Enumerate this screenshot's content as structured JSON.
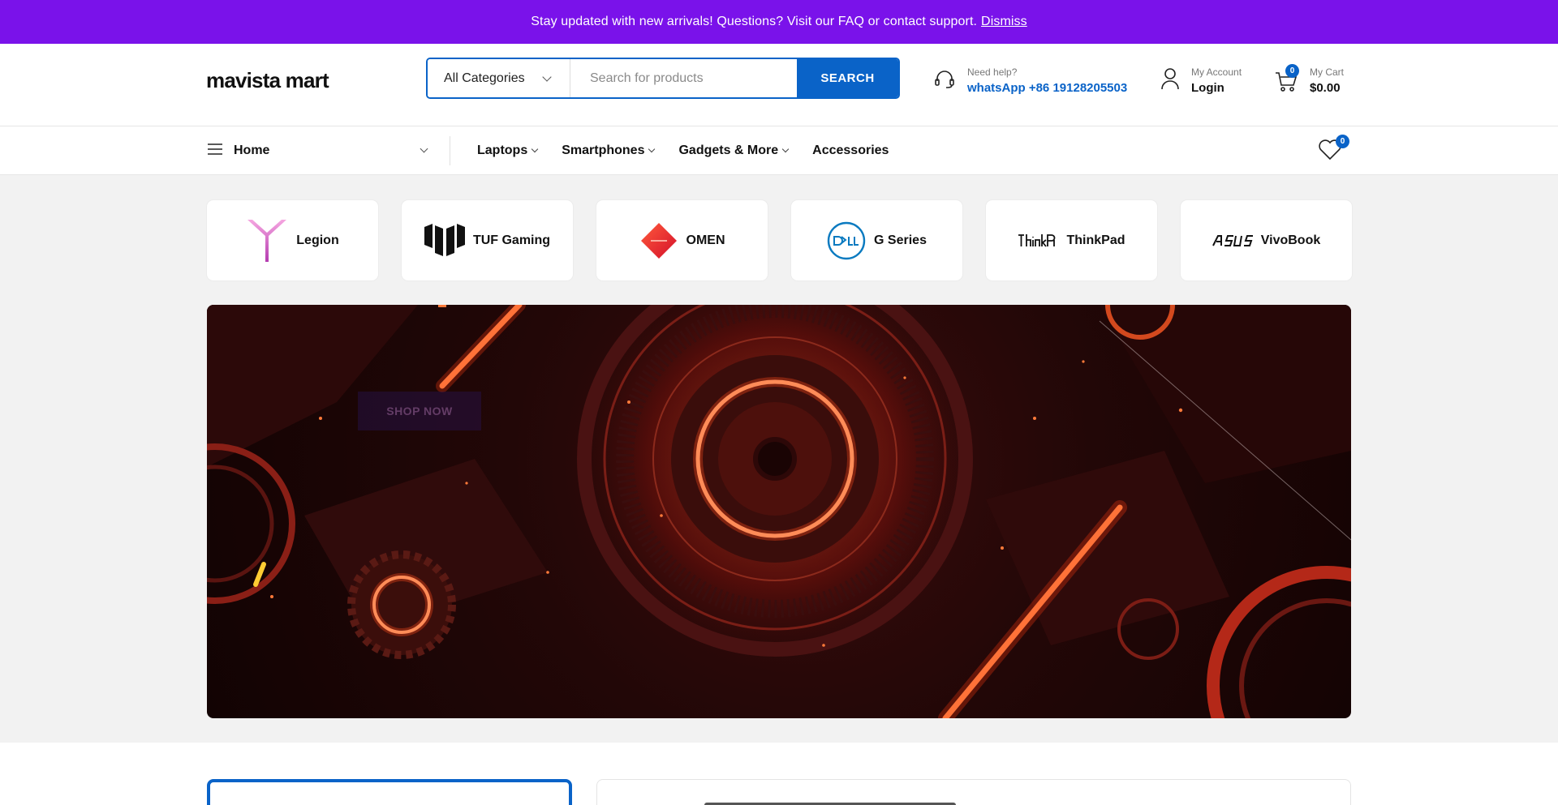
{
  "notice": {
    "message": "Stay updated with new arrivals! Questions? Visit our FAQ or contact support.",
    "dismiss": "Dismiss",
    "bg_color": "#7a12ea"
  },
  "header": {
    "logo": "mavista mart",
    "search": {
      "category": "All Categories",
      "placeholder": "Search for products",
      "value": "",
      "button": "SEARCH"
    },
    "help": {
      "label": "Need help?",
      "phone": "whatsApp +86 19128205503",
      "icon": "headset-icon"
    },
    "account": {
      "label": "My Account",
      "action": "Login",
      "icon": "user-icon"
    },
    "cart": {
      "label": "My Cart",
      "total": "$0.00",
      "count": "0",
      "icon": "cart-icon"
    },
    "accent_color": "#0a63c8"
  },
  "nav": {
    "home": "Home",
    "items": [
      {
        "label": "Laptops",
        "has_dropdown": true
      },
      {
        "label": "Smartphones",
        "has_dropdown": true
      },
      {
        "label": "Gadgets & More",
        "has_dropdown": true
      },
      {
        "label": "Accessories",
        "has_dropdown": false
      }
    ],
    "wishlist_count": "0"
  },
  "brands": [
    {
      "name": "Legion",
      "icon": "legion-logo-icon"
    },
    {
      "name": "TUF Gaming",
      "icon": "tuf-logo-icon"
    },
    {
      "name": "OMEN",
      "icon": "omen-logo-icon"
    },
    {
      "name": "G Series",
      "icon": "dell-logo-icon"
    },
    {
      "name": "ThinkPad",
      "icon": "thinkpad-logo-icon"
    },
    {
      "name": "VivoBook",
      "icon": "asus-logo-icon"
    }
  ],
  "banner": {
    "button": "SHOP NOW"
  }
}
